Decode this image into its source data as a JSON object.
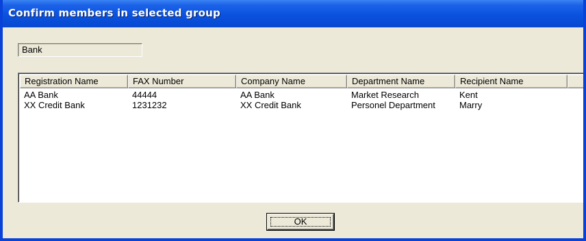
{
  "window": {
    "title": "Confirm members in selected group"
  },
  "group": {
    "name": "Bank"
  },
  "table": {
    "columns": [
      "Registration Name",
      "FAX Number",
      "Company Name",
      "Department Name",
      "Recipient Name"
    ],
    "rows": [
      [
        "AA Bank",
        "44444",
        "AA Bank",
        "Market Research",
        "Kent"
      ],
      [
        "XX Credit Bank",
        "1231232",
        "XX Credit Bank",
        "Personel Department",
        "Marry"
      ]
    ]
  },
  "buttons": {
    "ok_label": "OK"
  }
}
